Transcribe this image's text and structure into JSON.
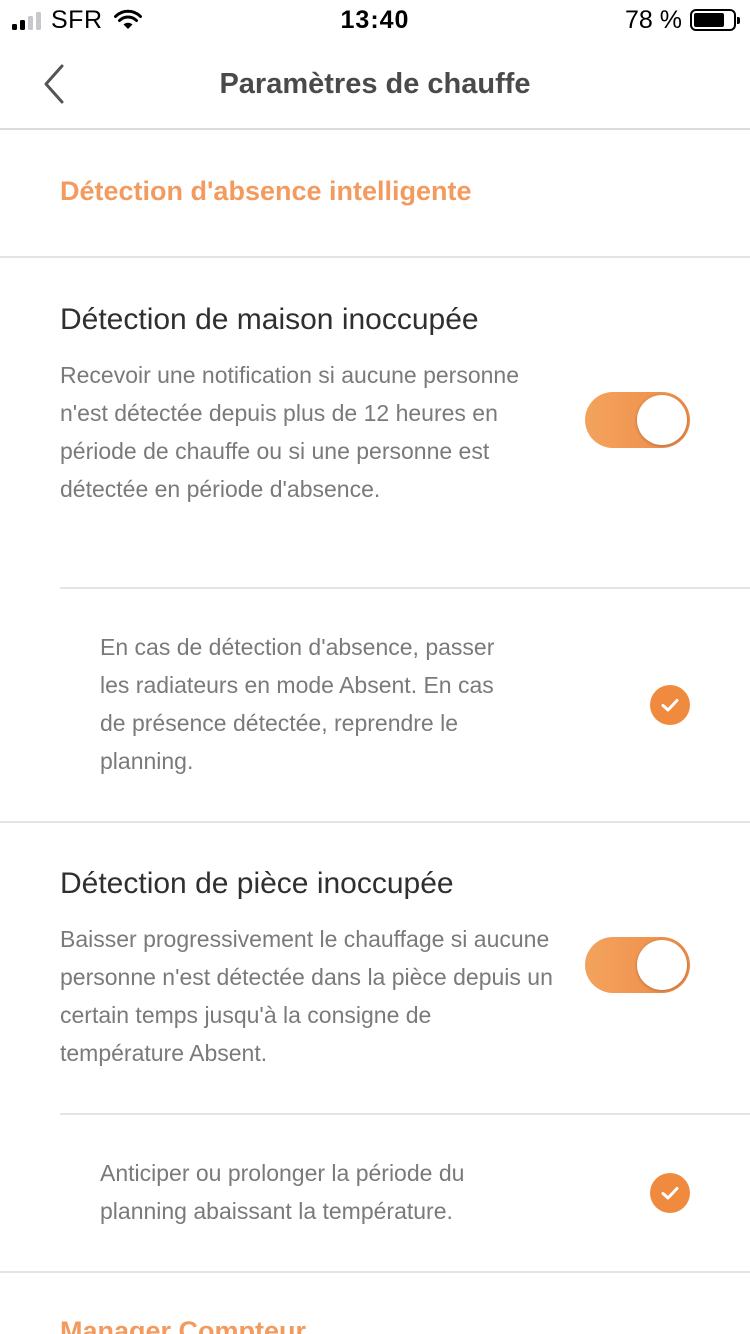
{
  "status_bar": {
    "carrier": "SFR",
    "time": "13:40",
    "battery": "78 %",
    "battery_level": 0.78
  },
  "nav": {
    "title": "Paramètres de chauffe",
    "back_icon": "chevron-left-icon"
  },
  "sections": {
    "absence_header": "Détection d'absence intelligente",
    "house": {
      "title": "Détection de maison inoccupée",
      "description": "Recevoir une notification si aucune personne n'est détectée depuis plus de 12 heures en période de chauffe ou si une personne est détectée en période d'absence.",
      "enabled": true,
      "option": {
        "text": "En cas de détection d'absence, passer les radiateurs en mode Absent. En cas de présence détectée, reprendre le planning.",
        "checked": true
      }
    },
    "room": {
      "title": "Détection de pièce inoccupée",
      "description": "Baisser progressivement le chauffage si aucune personne n'est détectée dans la pièce depuis un certain temps jusqu'à la consigne de température Absent.",
      "enabled": true,
      "option": {
        "text": "Anticiper ou prolonger la période du planning abaissant la température.",
        "checked": true
      }
    },
    "meter_header": "Manager Compteur"
  },
  "colors": {
    "accent": "#f39b5e",
    "toggle": "#ee8b48",
    "check": "#ef8a3e"
  }
}
